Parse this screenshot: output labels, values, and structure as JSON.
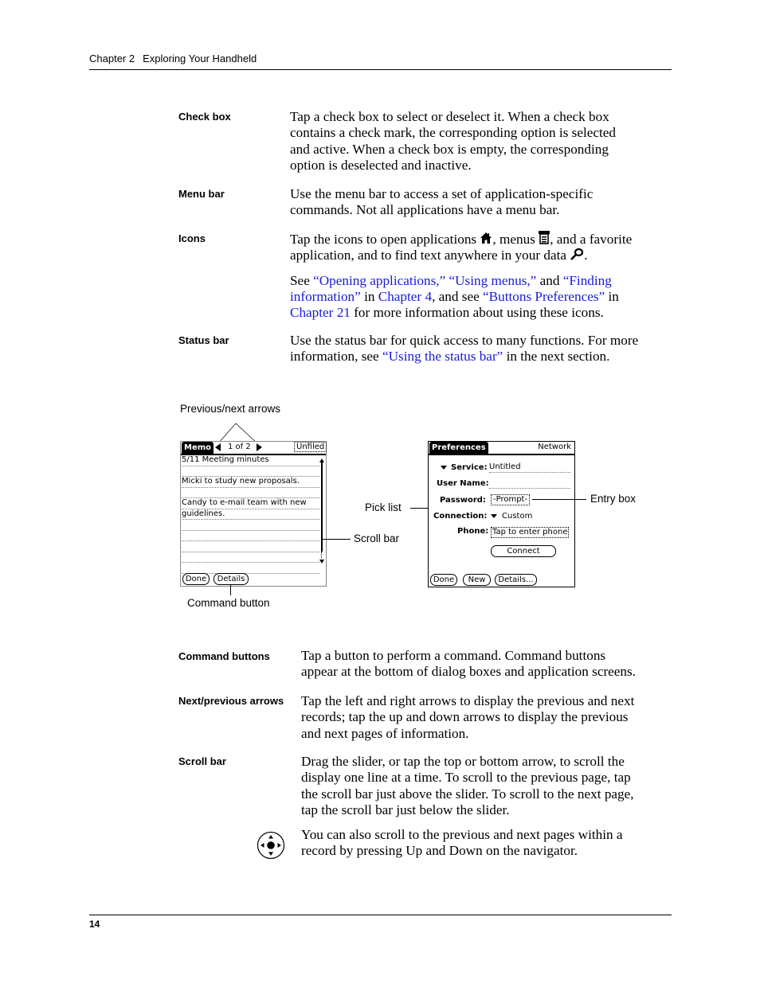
{
  "header": {
    "chapter": "Chapter 2",
    "title": "Exploring Your Handheld"
  },
  "definitions_top": [
    {
      "term": "Check box",
      "lines": [
        "Tap a check box to select or deselect it. When a check box",
        "contains a check mark, the corresponding option is selected",
        "and active. When a check box is empty, the corresponding",
        "option is deselected and inactive."
      ]
    },
    {
      "term": "Menu bar",
      "lines": [
        "Use the menu bar to access a set of application-specific",
        "commands. Not all applications have a menu bar."
      ]
    },
    {
      "term": "Icons",
      "p1": {
        "a": "Tap the icons to open applications ",
        "b": ", menus ",
        "c": ", and a favorite",
        "d": "application, and to find text anywhere in your data ",
        "e": "."
      },
      "p2": {
        "see": "See ",
        "l1": "“Opening applications,”",
        "l2": "“Using menus,”",
        "and": " and ",
        "l3a": "“Finding",
        "l3b": "information”",
        "in1": " in ",
        "l4": "Chapter 4",
        "andsee": ", and see ",
        "l5": "“Buttons Preferences”",
        "in2": " in",
        "l6": "Chapter 21",
        "rest": " for more information about using these icons."
      },
      "icons": [
        "home-icon",
        "menu-icon",
        "find-icon"
      ]
    },
    {
      "term": "Status bar",
      "l1": "Use the status bar for quick access to many functions. For more",
      "l2a": "information, see ",
      "link": "“Using the status bar”",
      "l2b": " in the next section."
    }
  ],
  "figure": {
    "callouts": {
      "prev_next": "Previous/next arrows",
      "command_button": "Command button",
      "scroll_bar": "Scroll bar",
      "pick_list": "Pick list",
      "entry_box": "Entry box"
    },
    "memo": {
      "title": "Memo",
      "counter": "1 of 2",
      "category": "Unfiled",
      "lines": [
        "5/11 Meeting minutes",
        "",
        "Micki to study new proposals.",
        "",
        "Candy to e-mail team with new",
        "guidelines.",
        "",
        "",
        "",
        "",
        ""
      ],
      "buttons": [
        "Done",
        "Details"
      ]
    },
    "prefs": {
      "title": "Preferences",
      "panel": "Network",
      "service_label": "Service:",
      "service_value": "Untitled",
      "username_label": "User Name:",
      "username_value": "",
      "password_label": "Password:",
      "password_value": "-Prompt-",
      "connection_label": "Connection:",
      "connection_value": "Custom",
      "phone_label": "Phone:",
      "phone_value": "Tap to enter phone",
      "connect_button": "Connect",
      "buttons": [
        "Done",
        "New",
        "Details..."
      ]
    }
  },
  "definitions_bottom": [
    {
      "term": "Command buttons",
      "lines": [
        "Tap a button to perform a command. Command buttons",
        "appear at the bottom of dialog boxes and application screens."
      ]
    },
    {
      "term": "Next/previous arrows",
      "lines": [
        "Tap the left and right arrows to display the previous and next",
        "records; tap the up and down arrows to display the previous",
        "and next pages of information."
      ]
    },
    {
      "term": "Scroll bar",
      "lines": [
        "Drag the slider, or tap the top or bottom arrow, to scroll the",
        "display one line at a time. To scroll to the previous page, tap",
        "the scroll bar just above the slider. To scroll to the next page,",
        "tap the scroll bar just below the slider."
      ]
    }
  ],
  "navigator_note": {
    "icon": "navigator-icon",
    "lines": [
      "You can also scroll to the previous and next pages within a",
      "record by pressing Up and Down on the navigator."
    ]
  },
  "footer": {
    "page_number": "14"
  }
}
